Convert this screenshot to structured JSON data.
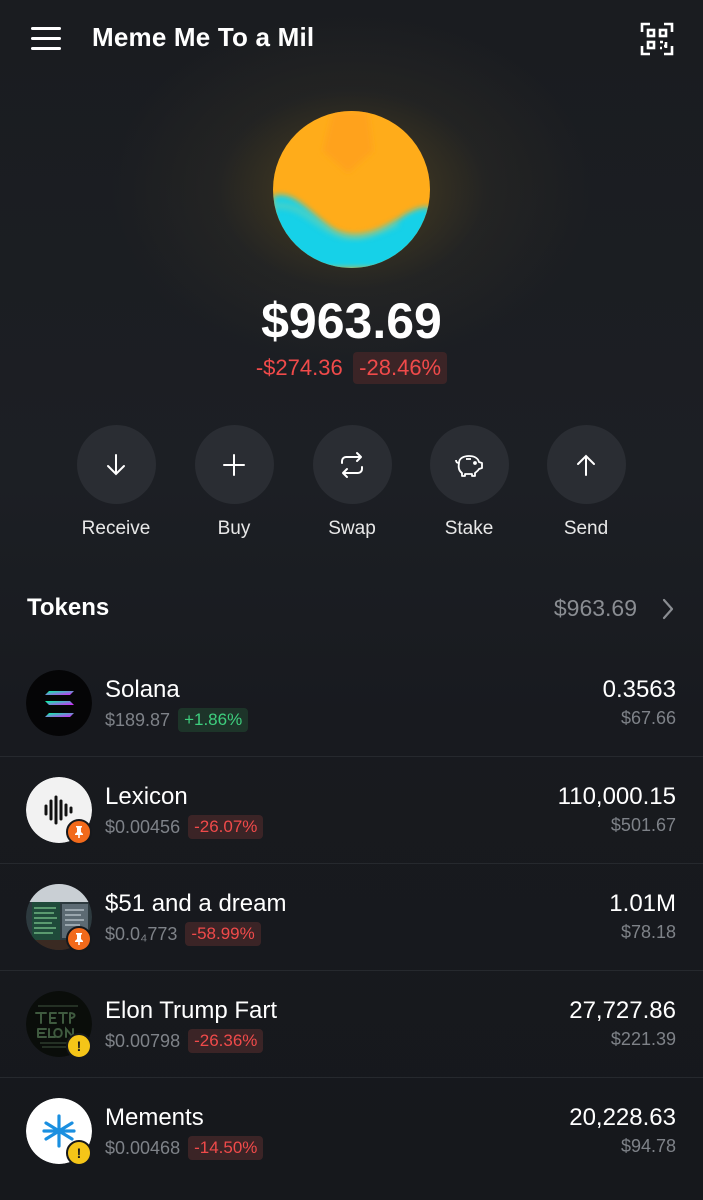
{
  "header": {
    "title": "Meme Me To a Mil",
    "menu_icon": "hamburger-menu-icon",
    "qr_icon": "qr-scan-icon"
  },
  "portfolio": {
    "balance": "$963.69",
    "change_abs": "-$274.36",
    "change_pct": "-28.46%",
    "avatar_colors": [
      "#ffac1a",
      "#16d1e8"
    ]
  },
  "actions": [
    {
      "label": "Receive",
      "icon": "arrow-down-icon"
    },
    {
      "label": "Buy",
      "icon": "plus-icon"
    },
    {
      "label": "Swap",
      "icon": "swap-icon"
    },
    {
      "label": "Stake",
      "icon": "piggy-bank-icon"
    },
    {
      "label": "Send",
      "icon": "arrow-up-icon"
    }
  ],
  "tokens": {
    "title": "Tokens",
    "total": "$963.69",
    "items": [
      {
        "name": "Solana",
        "price": "$189.87",
        "change": "+1.86%",
        "amount": "0.3563",
        "value": "$67.66",
        "badge": ""
      },
      {
        "name": "Lexicon",
        "price": "$0.00456",
        "change": "-26.07%",
        "amount": "110,000.15",
        "value": "$501.67",
        "badge": "pin"
      },
      {
        "name": "$51 and a dream",
        "price": "$0.0₄773",
        "change": "-58.99%",
        "amount": "1.01M",
        "value": "$78.18",
        "badge": "pin"
      },
      {
        "name": "Elon Trump Fart",
        "price": "$0.00798",
        "change": "-26.36%",
        "amount": "27,727.86",
        "value": "$221.39",
        "badge": "warn"
      },
      {
        "name": "Mements",
        "price": "$0.00468",
        "change": "-14.50%",
        "amount": "20,228.63",
        "value": "$94.78",
        "badge": "warn"
      }
    ]
  },
  "colors": {
    "accent_negative": "#f04a4a",
    "accent_positive": "#3ecf7e",
    "background": "#16181c",
    "action_circle": "#2a2d33"
  }
}
